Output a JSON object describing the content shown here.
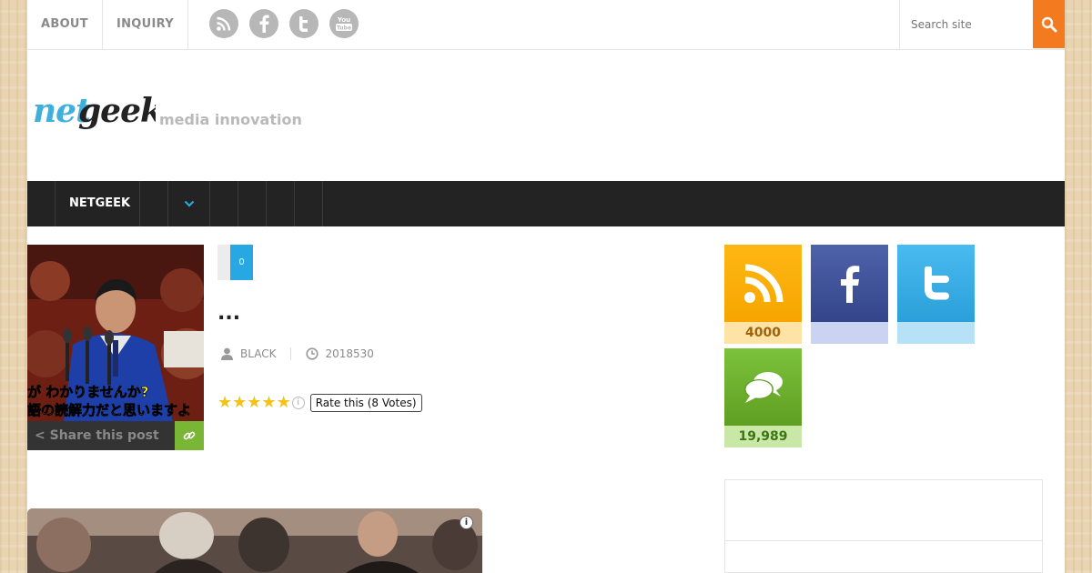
{
  "topnav": {
    "items": [
      "ABOUT",
      "INQUIRY"
    ]
  },
  "social_top": [
    "rss-icon",
    "facebook-icon",
    "twitter-icon",
    "youtube-icon"
  ],
  "social_top_text": {
    "youtube_label": "You Tube"
  },
  "search": {
    "placeholder": "Search site"
  },
  "header": {
    "logo_text": "netgeek",
    "tagline": "media innovation"
  },
  "mainnav": {
    "items": [
      "NETGEEK"
    ]
  },
  "post": {
    "comment_count": "0",
    "title": "...",
    "author": "BLACK",
    "date": "2018530",
    "rating_text": "Rate this (8 Votes)",
    "share_label": "Share this post",
    "caption_line1": "が わかりませんか?",
    "caption_line2": "語の読解力だと思いますよ"
  },
  "sidebar": {
    "rss": {
      "count": "4000"
    },
    "facebook": {
      "count": ""
    },
    "twitter": {
      "count": ""
    },
    "comments": {
      "count": "19,989"
    }
  },
  "colors": {
    "accent_orange": "#f47a20",
    "nav_dark": "#232323",
    "comment_blue": "#27a8e3",
    "share_green": "#7ab635",
    "rss_orange": "#f7a500",
    "facebook_blue": "#3b4c94",
    "twitter_blue": "#2fa9e3",
    "comments_green": "#6aab2b",
    "star_yellow": "#f3c21b"
  },
  "rating": {
    "value": 5,
    "max": 5
  }
}
